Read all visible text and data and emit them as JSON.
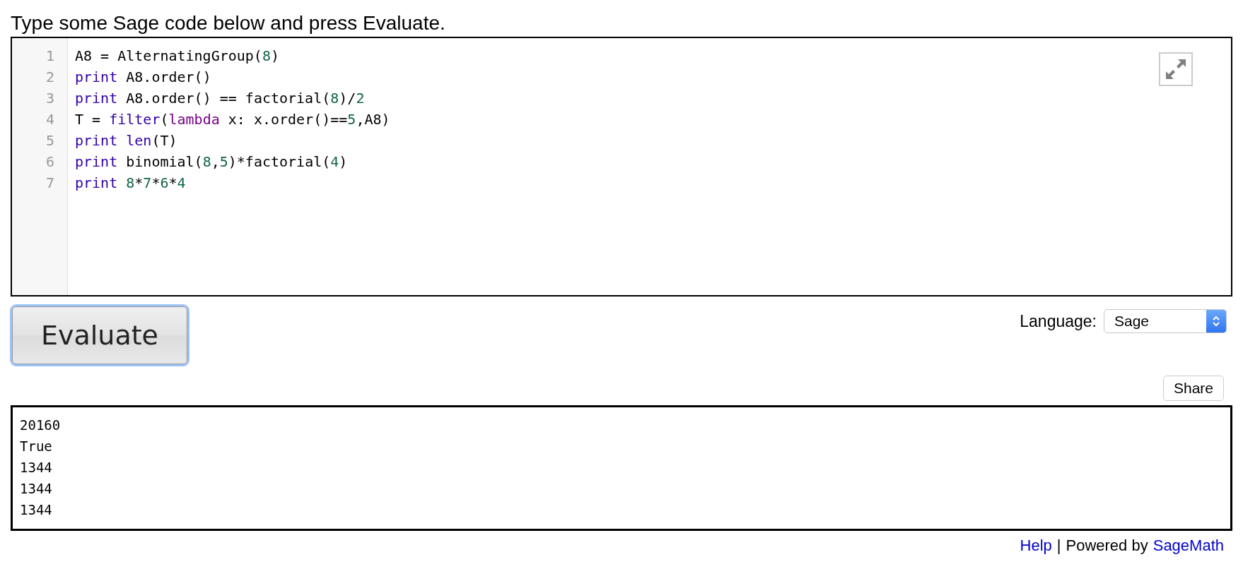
{
  "instructions": "Type some Sage code below and press Evaluate.",
  "editor": {
    "lines": [
      {
        "number": "1",
        "tokens": [
          {
            "kind": "plain",
            "text": "A8 = AlternatingGroup("
          },
          {
            "kind": "number",
            "text": "8"
          },
          {
            "kind": "plain",
            "text": ")"
          }
        ]
      },
      {
        "number": "2",
        "tokens": [
          {
            "kind": "builtin",
            "text": "print"
          },
          {
            "kind": "plain",
            "text": " A8.order()"
          }
        ]
      },
      {
        "number": "3",
        "tokens": [
          {
            "kind": "builtin",
            "text": "print"
          },
          {
            "kind": "plain",
            "text": " A8.order() == factorial("
          },
          {
            "kind": "number",
            "text": "8"
          },
          {
            "kind": "plain",
            "text": ")/"
          },
          {
            "kind": "number",
            "text": "2"
          }
        ]
      },
      {
        "number": "4",
        "tokens": [
          {
            "kind": "plain",
            "text": "T = "
          },
          {
            "kind": "builtin",
            "text": "filter"
          },
          {
            "kind": "plain",
            "text": "("
          },
          {
            "kind": "keyword",
            "text": "lambda"
          },
          {
            "kind": "plain",
            "text": " x: x.order()=="
          },
          {
            "kind": "number",
            "text": "5"
          },
          {
            "kind": "plain",
            "text": ",A8)"
          }
        ]
      },
      {
        "number": "5",
        "tokens": [
          {
            "kind": "builtin",
            "text": "print len"
          },
          {
            "kind": "plain",
            "text": "(T)"
          }
        ]
      },
      {
        "number": "6",
        "tokens": [
          {
            "kind": "builtin",
            "text": "print"
          },
          {
            "kind": "plain",
            "text": " binomial("
          },
          {
            "kind": "number",
            "text": "8"
          },
          {
            "kind": "plain",
            "text": ","
          },
          {
            "kind": "number",
            "text": "5"
          },
          {
            "kind": "plain",
            "text": ")*factorial("
          },
          {
            "kind": "number",
            "text": "4"
          },
          {
            "kind": "plain",
            "text": ")"
          }
        ]
      },
      {
        "number": "7",
        "tokens": [
          {
            "kind": "builtin",
            "text": "print "
          },
          {
            "kind": "number",
            "text": "8"
          },
          {
            "kind": "plain",
            "text": "*"
          },
          {
            "kind": "number",
            "text": "7"
          },
          {
            "kind": "plain",
            "text": "*"
          },
          {
            "kind": "number",
            "text": "6"
          },
          {
            "kind": "plain",
            "text": "*"
          },
          {
            "kind": "number",
            "text": "4"
          }
        ]
      }
    ]
  },
  "evaluate_button": "Evaluate",
  "language": {
    "label": "Language:",
    "value": "Sage"
  },
  "share_button": "Share",
  "output": [
    "20160",
    "True",
    "1344",
    "1344",
    "1344"
  ],
  "footer": {
    "help_link": "Help",
    "separator": "|",
    "powered_by": "Powered by",
    "sagemath_link": "SageMath"
  }
}
